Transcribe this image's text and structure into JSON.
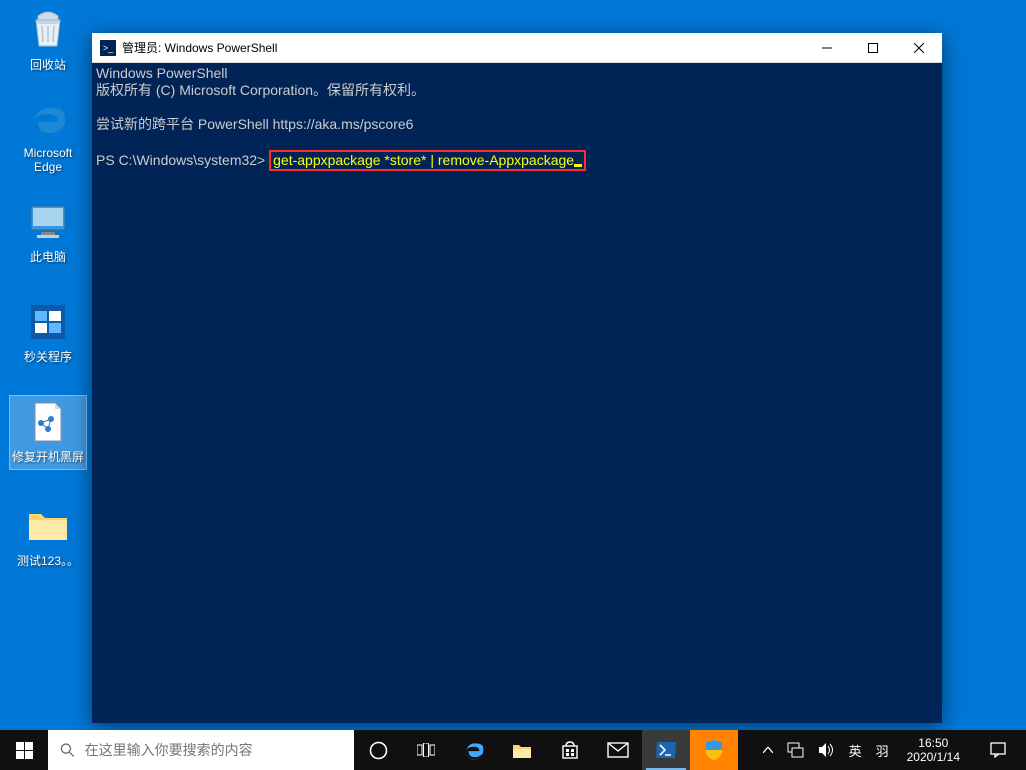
{
  "desktop": {
    "icons": [
      {
        "label": "回收站"
      },
      {
        "label": "Microsoft Edge"
      },
      {
        "label": "此电脑"
      },
      {
        "label": "秒关程序"
      },
      {
        "label": "修复开机黑屏"
      },
      {
        "label": "测试123。。"
      }
    ]
  },
  "window": {
    "title": "管理员: Windows PowerShell",
    "console": {
      "line1": "Windows PowerShell",
      "line2": "版权所有 (C) Microsoft Corporation。保留所有权利。",
      "line3": "尝试新的跨平台 PowerShell https://aka.ms/pscore6",
      "prompt": "PS C:\\Windows\\system32> ",
      "cmd1": "get-appxpackage *store* ",
      "pipe": "|",
      "cmd2": " remove-Appxpackage"
    }
  },
  "taskbar": {
    "search_placeholder": "在这里输入你要搜索的内容",
    "ime": "英",
    "ime2": "羽",
    "time": "16:50",
    "date": "2020/1/14"
  }
}
